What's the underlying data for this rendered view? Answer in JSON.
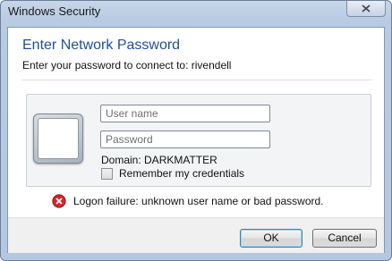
{
  "window": {
    "title": "Windows Security"
  },
  "header": {
    "title": "Enter Network Password",
    "subtitle": "Enter your password to connect to: rivendell"
  },
  "credentials": {
    "username_placeholder": "User name",
    "password_placeholder": "Password",
    "domain_label": "Domain: DARKMATTER",
    "remember_label": "Remember my credentials",
    "remember_checked": false
  },
  "error": {
    "message": "Logon failure: unknown user name or bad password."
  },
  "buttons": {
    "ok": "OK",
    "cancel": "Cancel"
  },
  "icons": {
    "close": "close-icon",
    "error": "error-icon",
    "user": "user-tile-icon"
  },
  "colors": {
    "title_blue": "#1f4f99",
    "error_red": "#d0272c",
    "ok_border": "#3c7fb1"
  }
}
